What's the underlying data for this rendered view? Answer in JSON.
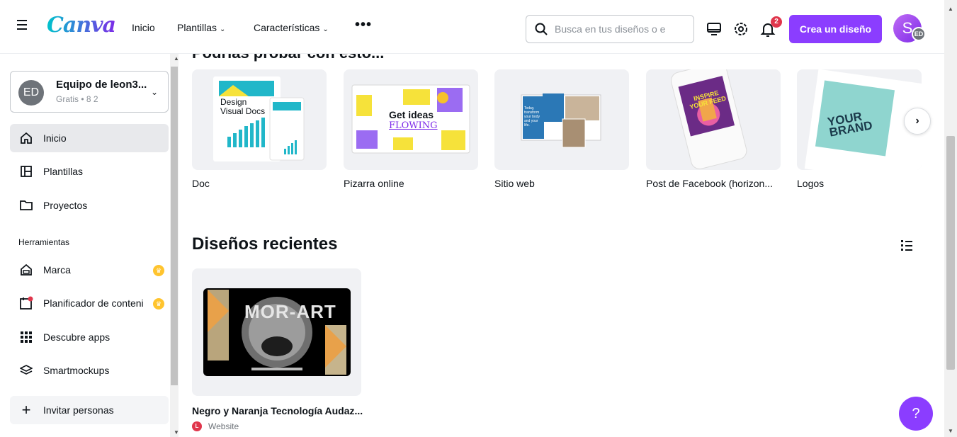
{
  "header": {
    "logo": "Canva",
    "nav": [
      {
        "label": "Inicio",
        "has_chevron": false
      },
      {
        "label": "Plantillas",
        "has_chevron": true
      },
      {
        "label": "Características",
        "has_chevron": true
      }
    ],
    "more_label": "•••",
    "search_placeholder": "Busca en tus diseños o e",
    "notification_count": "2",
    "create_button": "Crea un diseño",
    "avatar_letter": "S",
    "avatar_badge": "ED"
  },
  "sidebar": {
    "team": {
      "avatar": "ED",
      "name": "Equipo de leon3...",
      "sub": "Gratis • 8 2"
    },
    "nav": [
      {
        "label": "Inicio",
        "icon": "home-icon",
        "active": true
      },
      {
        "label": "Plantillas",
        "icon": "templates-icon",
        "active": false
      },
      {
        "label": "Proyectos",
        "icon": "folder-icon",
        "active": false
      }
    ],
    "tools_heading": "Herramientas",
    "tools": [
      {
        "label": "Marca",
        "icon": "brand-icon",
        "premium": true
      },
      {
        "label": "Planificador de conteni",
        "icon": "calendar-icon",
        "premium": true
      },
      {
        "label": "Descubre apps",
        "icon": "apps-grid-icon",
        "premium": false
      },
      {
        "label": "Smartmockups",
        "icon": "layers-icon",
        "premium": false
      }
    ],
    "invite": "Invitar personas"
  },
  "main": {
    "section_title_cut": "Podrías probar con esto...",
    "templates": [
      {
        "label": "Doc",
        "icon": "doc-thumbnail"
      },
      {
        "label": "Pizarra online",
        "icon": "whiteboard-thumbnail"
      },
      {
        "label": "Sitio web",
        "icon": "website-thumbnail"
      },
      {
        "label": "Post de Facebook (horizon...",
        "icon": "facebook-post-thumbnail"
      },
      {
        "label": "Logos",
        "icon": "logo-thumbnail"
      }
    ],
    "thumb_text": {
      "doc_title": "Design Visual Docs",
      "board_title": "Get ideas",
      "board_sub": "FLOWING",
      "web_text": "Today, transform your body and your life.",
      "fb_text": "INSPIRE YOUR FEED",
      "logo_text": "YOUR BRAND"
    },
    "recent_title": "Diseños recientes",
    "recent": [
      {
        "name": "Negro y Naranja Tecnología Audaz...",
        "type": "Website",
        "thumb_title": "MOR-ART"
      }
    ]
  },
  "help_label": "?",
  "colors": {
    "brand_purple": "#8b3dff",
    "canva_teal": "#00c4cc",
    "active_bg": "#e8e9ec",
    "notif_red": "#e0364c"
  }
}
